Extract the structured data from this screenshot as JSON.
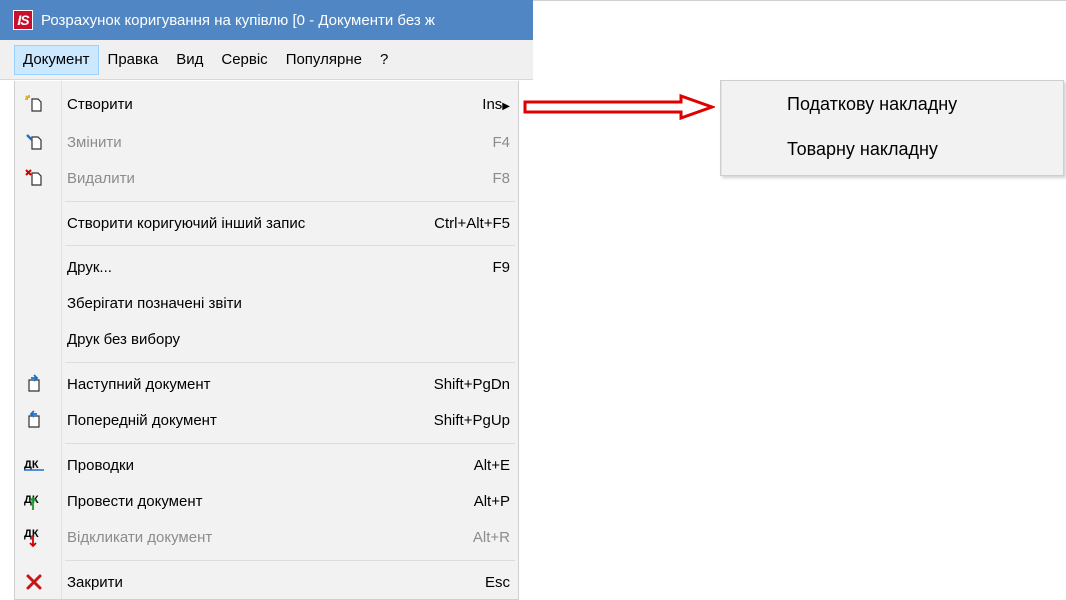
{
  "window": {
    "title": "Розрахунок коригування на купівлю [0 - Документи без ж",
    "logo_text": "IS"
  },
  "menubar": {
    "items": [
      {
        "label": "Документ",
        "active": true
      },
      {
        "label": "Правка"
      },
      {
        "label": "Вид"
      },
      {
        "label": "Сервіс"
      },
      {
        "label": "Популярне"
      },
      {
        "label": "?"
      }
    ]
  },
  "menu": {
    "create": {
      "label": "Створити",
      "shortcut": "Ins",
      "icon": "new-doc-icon"
    },
    "edit": {
      "label": "Змінити",
      "shortcut": "F4",
      "icon": "edit-doc-icon",
      "disabled": true
    },
    "delete": {
      "label": "Видалити",
      "shortcut": "F8",
      "icon": "delete-doc-icon",
      "disabled": true
    },
    "create_correcting": {
      "label": "Створити коригуючий інший запис",
      "shortcut": "Ctrl+Alt+F5"
    },
    "print": {
      "label": "Друк...",
      "shortcut": "F9"
    },
    "save_reports": {
      "label": "Зберігати позначені звіти"
    },
    "print_no_select": {
      "label": "Друк без вибору"
    },
    "next_doc": {
      "label": "Наступний документ",
      "shortcut": "Shift+PgDn",
      "icon": "next-doc-icon"
    },
    "prev_doc": {
      "label": "Попередній документ",
      "shortcut": "Shift+PgUp",
      "icon": "prev-doc-icon"
    },
    "postings": {
      "label": "Проводки",
      "shortcut": "Alt+E",
      "icon": "dk-icon",
      "icon_text": "ДК"
    },
    "post_doc": {
      "label": "Провести документ",
      "shortcut": "Alt+P",
      "icon": "dk-post-icon",
      "icon_text": "ДК"
    },
    "unpost_doc": {
      "label": "Відкликати документ",
      "shortcut": "Alt+R",
      "icon": "dk-unpost-icon",
      "icon_text": "ДК",
      "disabled": true
    },
    "close": {
      "label": "Закрити",
      "shortcut": "Esc",
      "icon": "close-icon"
    }
  },
  "submenu": {
    "items": [
      {
        "label": "Податкову накладну"
      },
      {
        "label": "Товарну накладну"
      }
    ]
  },
  "colors": {
    "titlebar": "#4f86c3",
    "menu_active": "#cce8ff",
    "arrow": "#e00000"
  }
}
